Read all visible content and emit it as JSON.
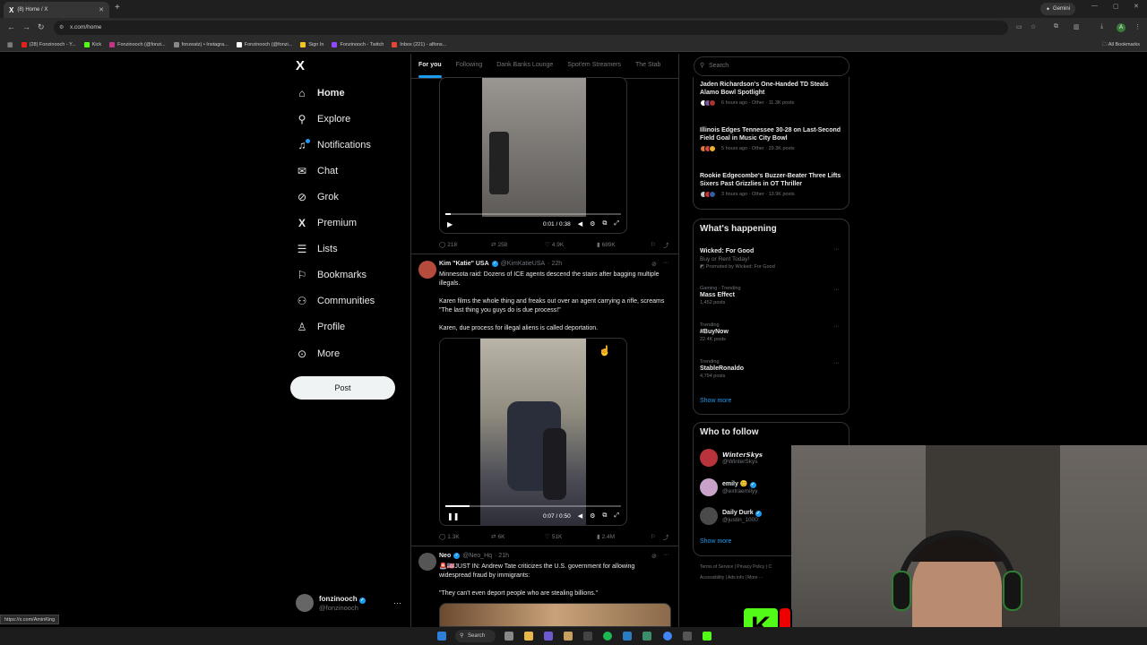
{
  "browser": {
    "tab_title": "(8) Home / X",
    "tab_logo": "X",
    "new_tab": "+",
    "gemini": "Gemini",
    "url": "x.com/home",
    "bookmarks": [
      {
        "label": "(28) Fonzinooch - Y...",
        "color": "#e62117"
      },
      {
        "label": "Kick",
        "color": "#53fc18"
      },
      {
        "label": "Fonzinooch (@fonzi...",
        "color": "#c13584"
      },
      {
        "label": "fonzeatz) • Instagra...",
        "color": "#888888"
      },
      {
        "label": "Fonzinooch (@fonzi...",
        "color": "#ffffff"
      },
      {
        "label": "Sign In",
        "color": "#f5c518"
      },
      {
        "label": "Fonzinooch - Twitch",
        "color": "#9146ff"
      },
      {
        "label": "Inbox (221) - alfons...",
        "color": "#ea4335"
      }
    ],
    "all_bookmarks": "All Bookmarks",
    "status_url": "https://x.com/AminKing"
  },
  "nav": {
    "logo": "X",
    "items": [
      {
        "label": "Home",
        "icon": "⌂"
      },
      {
        "label": "Explore",
        "icon": "⚲"
      },
      {
        "label": "Notifications",
        "icon": "🔔"
      },
      {
        "label": "Chat",
        "icon": "✉"
      },
      {
        "label": "Grok",
        "icon": "◪"
      },
      {
        "label": "Premium",
        "icon": "X"
      },
      {
        "label": "Lists",
        "icon": "☰"
      },
      {
        "label": "Bookmarks",
        "icon": "⚑"
      },
      {
        "label": "Communities",
        "icon": "⚇"
      },
      {
        "label": "Profile",
        "icon": "♙"
      },
      {
        "label": "More",
        "icon": "⋯"
      }
    ],
    "post_button": "Post",
    "account": {
      "name": "fonzinooch",
      "handle": "@fonzinooch",
      "more": "···"
    }
  },
  "feed": {
    "tabs": [
      "For you",
      "Following",
      "Dank Banks Lounge",
      "Spot'em Streamers",
      "The Stab"
    ],
    "video1": {
      "time": "0:01 / 0:38",
      "progress": 0.03
    },
    "tweet1_stats": {
      "replies": "218",
      "reposts": "258",
      "likes": "4.9K",
      "views": "689K"
    },
    "tweet2": {
      "name": "Kim \"Katie\" USA",
      "handle": "@KimKatieUSA",
      "time": "· 22h",
      "text1": "Minnesota raid: Dozens of ICE agents descend the stairs after bagging multiple illegals.",
      "text2": "Karen films the whole thing and freaks out over an agent carrying a rifle, screams \"The last thing you guys do is due process!\"",
      "text3": "Karen, due process for illegal aliens is called deportation.",
      "video_time": "0:07 / 0:50",
      "video_progress": 0.14,
      "stats": {
        "replies": "1.3K",
        "reposts": "6K",
        "likes": "51K",
        "views": "2.4M"
      }
    },
    "tweet3": {
      "name": "Neo",
      "handle": "@Neo_Hq",
      "time": "· 21h",
      "text1": "🚨🇺🇸JUST IN: Andrew Tate criticizes the U.S. government for allowing widespread fraud by immigrants:",
      "text2": "\"They can't even deport people who are stealing billions.\""
    }
  },
  "right": {
    "search_placeholder": "Search",
    "news": [
      {
        "title": "Jaden Richardson's One-Handed TD Steals Alamo Bowl Spotlight",
        "meta": "6 hours ago · Other · 11.3K posts"
      },
      {
        "title": "Illinois Edges Tennessee 30-28 on Last-Second Field Goal in Music City Bowl",
        "meta": "5 hours ago · Other · 29.3K posts"
      },
      {
        "title": "Rookie Edgecombe's Buzzer-Beater Three Lifts Sixers Past Grizzlies in OT Thriller",
        "meta": "3 hours ago · Other · 13.9K posts"
      }
    ],
    "happening_title": "What's happening",
    "trends": [
      {
        "ctx": "",
        "title": "Wicked: For Good",
        "sub": "Buy or Rent Today!",
        "cnt": "Promoted by Wicked: For Good"
      },
      {
        "ctx": "Gaming · Trending",
        "title": "Mass Effect",
        "sub": "",
        "cnt": "1,452 posts"
      },
      {
        "ctx": "Trending",
        "title": "#BuyNow",
        "sub": "",
        "cnt": "22.4K posts"
      },
      {
        "ctx": "Trending",
        "title": "StableRonaldo",
        "sub": "",
        "cnt": "4,794 posts"
      }
    ],
    "show_more": "Show more",
    "follow_title": "Who to follow",
    "follow": [
      {
        "name": "𝙒𝙞𝙣𝙩𝙚𝙧𝙎𝙠𝙮𝙨",
        "handle": "@WinterSkys",
        "color": "#b8333c"
      },
      {
        "name": "emily 😊",
        "handle": "@extraemilyy",
        "color": "#c8a2c8"
      },
      {
        "name": "Daily Durk",
        "handle": "@justin_1000",
        "color": "#4a4a4a"
      }
    ],
    "footer1": "Terms of Service  |  Privacy Policy  |  C",
    "footer2": "Accessibility  |  Ads info  |  More ···"
  },
  "overlay": {
    "kick_logo": "K"
  },
  "taskbar": {
    "search": "Search"
  }
}
